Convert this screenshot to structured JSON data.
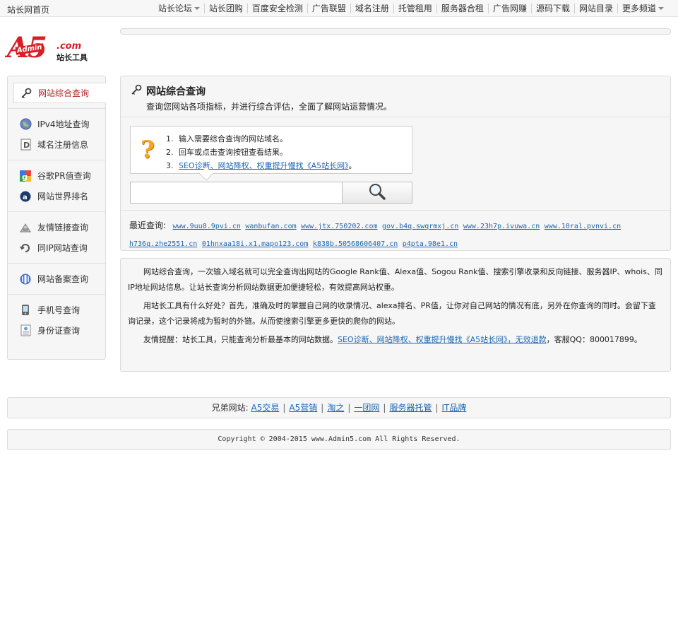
{
  "topbar": {
    "home": "站长网首页",
    "nav": [
      {
        "label": "站长论坛",
        "dropdown": true
      },
      {
        "label": "站长团购"
      },
      {
        "label": "百度安全检测"
      },
      {
        "label": "广告联盟"
      },
      {
        "label": "域名注册"
      },
      {
        "label": "托管租用"
      },
      {
        "label": "服务器合租"
      },
      {
        "label": "广告网赚"
      },
      {
        "label": "源码下载"
      },
      {
        "label": "网站目录"
      },
      {
        "label": "更多频道",
        "dropdown": true
      }
    ]
  },
  "logo": {
    "brand": "A5",
    "admin": "Admin",
    "com": ".com",
    "tool": "站长工具"
  },
  "sidebar": {
    "groups": [
      [
        {
          "label": "网站综合查询",
          "icon": "key-icon",
          "active": true
        }
      ],
      [
        {
          "label": "IPv4地址查询",
          "icon": "globe-icon"
        },
        {
          "label": "域名注册信息",
          "icon": "document-d-icon"
        }
      ],
      [
        {
          "label": "谷歌PR值查询",
          "icon": "google-icon"
        },
        {
          "label": "网站世界排名",
          "icon": "alexa-icon"
        }
      ],
      [
        {
          "label": "友情链接查询",
          "icon": "link-icon"
        },
        {
          "label": "同IP网站查询",
          "icon": "ip-icon"
        }
      ],
      [
        {
          "label": "网站备案查询",
          "icon": "record-icon"
        }
      ],
      [
        {
          "label": "手机号查询",
          "icon": "phone-icon"
        },
        {
          "label": "身份证查询",
          "icon": "idcard-icon"
        }
      ]
    ]
  },
  "panel": {
    "title": "网站综合查询",
    "desc": "查询您网站各项指标，并进行综合评估，全面了解网站运营情况。",
    "tips": [
      {
        "n": "1.",
        "text": "输入需要综合查询的网站域名。"
      },
      {
        "n": "2.",
        "text": "回车或点击查询按钮查看结果。"
      },
      {
        "n": "3.",
        "text": "SEO诊断、网站降权、权重提升慢找《A5站长网》",
        "tail": "。"
      }
    ],
    "search_value": "",
    "recent_label": "最近查询:",
    "recent": [
      "www.9uu8.9pvi.cn",
      "wanbufan.com",
      "www.jtx.750202.com",
      "gov.b4q.swqrmxj.cn",
      "www.23h7p.ivuwa.cn",
      "www.10ral.pvnvi.cn",
      "h736q.zhe2551.cn",
      "01hnxaa18i.x1.mapo123.com",
      "k838b.50568606407.cn",
      "p4pta.98e1.cn"
    ]
  },
  "info": {
    "p1": "网站综合查询，一次输入域名就可以完全查询出网站的Google Rank值、Alexa值、Sogou Rank值、搜索引擎收录和反向链接、服务器IP、whois、同IP地址网站信息。让站长查询分析网站数据更加便捷轻松，有效提高网站权重。",
    "p2": "用站长工具有什么好处？首先，准确及时的掌握自己网的收录情况、alexa排名、PR值，让你对自己网站的情况有底，另外在你查询的同时。会留下查询记录，这个记录将成为暂时的外链。从而使搜索引擎更多更快的爬你的网站。",
    "p3_pre": "友情提醒：站长工具，只能查询分析最基本的网站数据。",
    "p3_link": "SEO诊断、网站降权、权重提升慢找《A5站长网》，无效退款",
    "p3_post": "，客服QQ：800017899。"
  },
  "friends": {
    "label": "兄弟网站:",
    "links": [
      "A5交易",
      "A5营销",
      "淘之",
      "一团网",
      "服务器托管",
      "IT品牌"
    ]
  },
  "copyright": "Copyright © 2004-2015 www.Admin5.com All Rights Reserved."
}
